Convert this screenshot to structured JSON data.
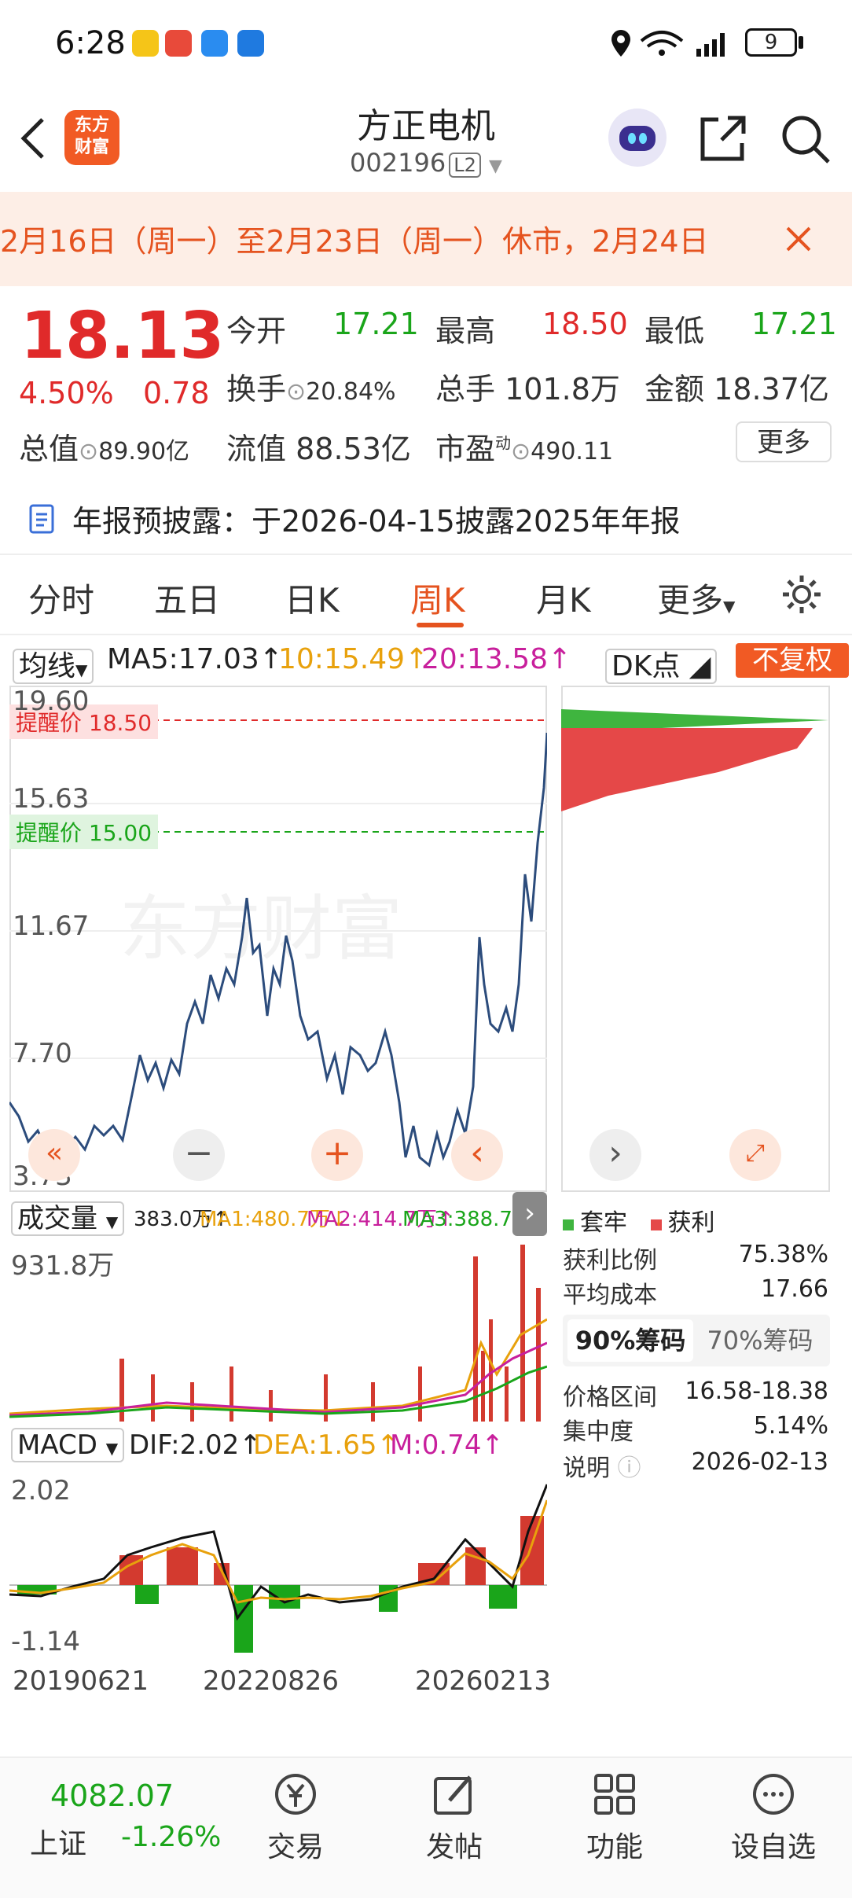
{
  "status_bar": {
    "time": "6:28",
    "battery": "9"
  },
  "header": {
    "title": "方正电机",
    "code": "002196",
    "level": "L2",
    "logo_line1": "东方",
    "logo_line2": "财富"
  },
  "notice": {
    "text": "2月16日（周一）至2月23日（周一）休市，2月24日"
  },
  "quote": {
    "price": "18.13",
    "change_pct": "4.50%",
    "change": "0.78",
    "open_label": "今开",
    "open": "17.21",
    "high_label": "最高",
    "high": "18.50",
    "low_label": "最低",
    "low": "17.21",
    "turnover_label": "换手",
    "turnover": "20.84%",
    "volume_label": "总手",
    "volume": "101.8万",
    "amount_label": "金额",
    "amount": "18.37亿",
    "total_value_label": "总值",
    "total_value": "89.90亿",
    "float_value_label": "流值",
    "float_value": "88.53亿",
    "pe_label": "市盈",
    "pe_sup": "动",
    "pe": "490.11",
    "more": "更多"
  },
  "report": {
    "text": "年报预披露：于2026-04-15披露2025年年报"
  },
  "tabs": [
    "分时",
    "五日",
    "日K",
    "周K",
    "月K",
    "更多"
  ],
  "indicators": {
    "ma_select": "均线",
    "ma5": "MA5:17.03↑",
    "ma10": "10:15.49↑",
    "ma20": "20:13.58↑",
    "dk": "DK点",
    "fq": "不复权"
  },
  "kchart": {
    "alert_high": "提醒价 18.50",
    "alert_low": "提醒价 15.00",
    "ticks": [
      "19.60",
      "15.63",
      "11.67",
      "7.70",
      "3.73"
    ],
    "watermark": "东方财富"
  },
  "volume": {
    "select": "成交量",
    "v": "383.0万↑",
    "ma1": "MA1:480.7万↓",
    "ma2": "MA2:414.7万↑",
    "ma3": "MA3:388.7万↑",
    "max": "931.8万"
  },
  "macd": {
    "select": "MACD",
    "dif": "DIF:2.02↑",
    "dea": "DEA:1.65↑",
    "m": "M:0.74↑",
    "top": "2.02",
    "bottom": "-1.14"
  },
  "x_axis": [
    "20190621",
    "20220826",
    "20260213"
  ],
  "chips": {
    "legend_trapped": "套牢",
    "legend_profit": "获利",
    "profit_ratio_label": "获利比例",
    "profit_ratio": "75.38%",
    "avg_cost_label": "平均成本",
    "avg_cost": "17.66",
    "seg_on": "90%筹码",
    "seg_off": "70%筹码",
    "range_label": "价格区间",
    "range": "16.58-18.38",
    "conc_label": "集中度",
    "conc": "5.14%",
    "note_label": "说明",
    "note": "2026-02-13"
  },
  "bottom": {
    "index_value": "4082.07",
    "index_name": "上证",
    "index_pct": "-1.26%",
    "items": [
      "交易",
      "发帖",
      "功能",
      "设自选"
    ]
  },
  "colors": {
    "up": "#e02a2a",
    "down": "#1aa51a",
    "accent": "#e5531f",
    "line": "#2c4c7c"
  }
}
